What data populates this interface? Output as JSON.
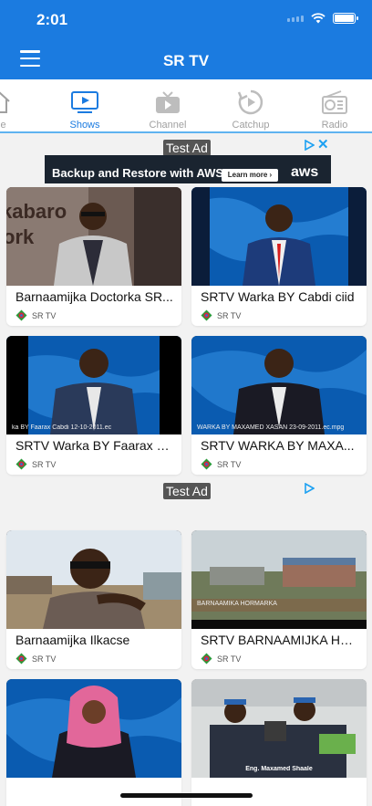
{
  "status_bar": {
    "time": "2:01"
  },
  "header": {
    "title": "SR TV",
    "menu_icon": "hamburger-menu-icon"
  },
  "colors": {
    "brand_blue": "#1b7be0",
    "tab_underline": "#5fb3f0",
    "inactive_gray": "#a0a0a0"
  },
  "tabs": [
    {
      "label": "me",
      "icon": "home-icon",
      "active": false
    },
    {
      "label": "Shows",
      "icon": "tv-play-icon",
      "active": true
    },
    {
      "label": "Channel",
      "icon": "tv-icon",
      "active": false
    },
    {
      "label": "Catchup",
      "icon": "replay-icon",
      "active": false
    },
    {
      "label": "Radio",
      "icon": "radio-icon",
      "active": false
    }
  ],
  "ads": [
    {
      "label": "Test Ad",
      "banner_text": "Backup and Restore with AWS",
      "banner_button": "Learn more ›",
      "banner_logo": "aws"
    },
    {
      "label": "Test Ad"
    }
  ],
  "cards": [
    {
      "title": "Barnaamijka Doctorka SR...",
      "channel": "SR TV",
      "caption": ""
    },
    {
      "title": "SRTV Warka BY Cabdi ciid",
      "channel": "SR TV",
      "caption": ""
    },
    {
      "title": "SRTV Warka BY Faarax C...",
      "channel": "SR TV",
      "caption": "ka BY Faarax Cabdi 12-10-2011.ec"
    },
    {
      "title": "SRTV WARKA BY MAXA...",
      "channel": "SR TV",
      "caption": "WARKA BY    MAXAMED XASAN   23-09-2011.ec.mpg"
    },
    {
      "title": "Barnaamijka Ilkacse",
      "channel": "SR TV",
      "caption": ""
    },
    {
      "title": "SRTV BARNAAMIJKA HO...",
      "channel": "SR TV",
      "caption": "BARNAAMIKA HORMARKA"
    },
    {
      "title": "",
      "channel": "",
      "caption": ""
    },
    {
      "title": "",
      "channel": "",
      "caption": "Eng. Maxamed Shaale"
    }
  ]
}
